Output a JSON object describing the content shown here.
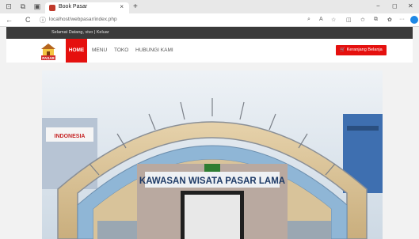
{
  "browser": {
    "tab_title": "Book Pasar",
    "tab_close": "×",
    "new_tab": "+",
    "url": "localhost/webpasar/index.php",
    "back": "←",
    "reload": "C",
    "info": "ⓘ",
    "window_min": "−",
    "window_max": "◻",
    "window_close": "✕",
    "more": "···"
  },
  "site": {
    "greeting": "Selamat Datang, vivo  |  Keluar",
    "logo_text": "PASAR",
    "nav": {
      "home": "HOME",
      "menu": "MENU",
      "toko": "TOKO",
      "kontak": "HUBUNGI KAMI"
    },
    "cart_button": "Keranjang Belanja",
    "hero": {
      "caption": "KAWASAN WISATA PASAR LAMA",
      "shop_sign": "INDONESIA"
    }
  },
  "colors": {
    "accent": "#e5100e",
    "topstrip": "#3a3a3a"
  }
}
